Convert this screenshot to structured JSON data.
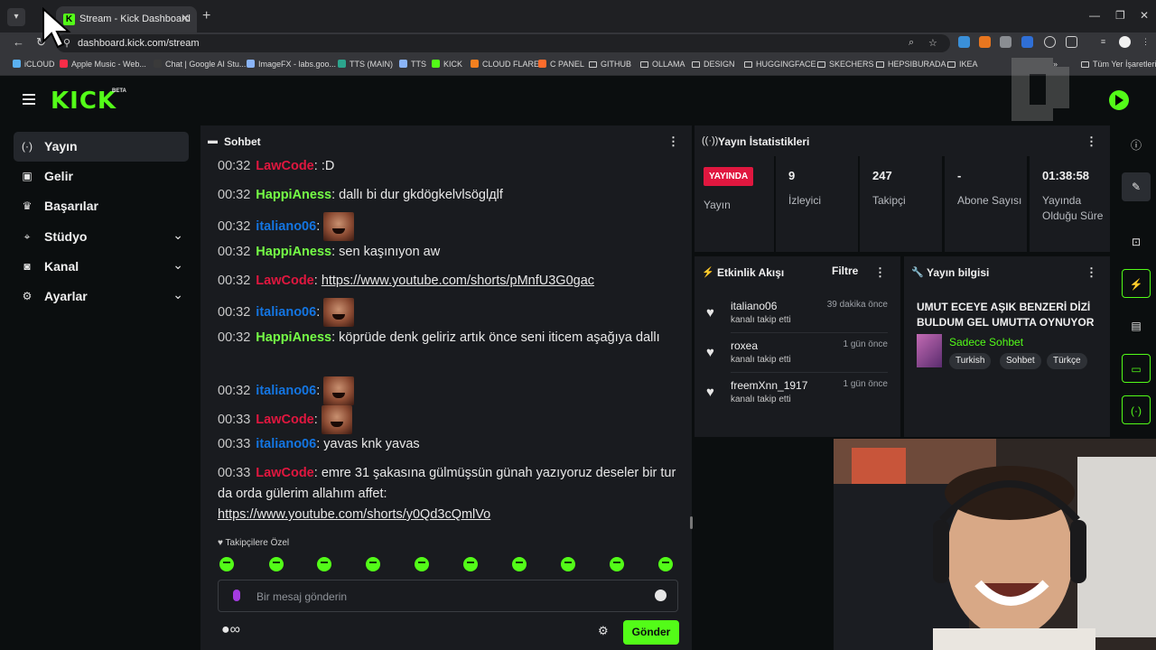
{
  "browser": {
    "tab_title": "Stream - Kick Dashboard",
    "new_tab": "+",
    "url": "dashboard.kick.com/stream",
    "bookmarks": [
      {
        "label": "iCLOUD",
        "kind": "site"
      },
      {
        "label": "Apple Music - Web...",
        "kind": "site"
      },
      {
        "label": "Chat | Google AI Stu...",
        "kind": "site"
      },
      {
        "label": "ImageFX - labs.goo...",
        "kind": "site"
      },
      {
        "label": "TTS (MAIN)",
        "kind": "site"
      },
      {
        "label": "TTS",
        "kind": "site"
      },
      {
        "label": "KICK",
        "kind": "site"
      },
      {
        "label": "CLOUD FLARE",
        "kind": "site"
      },
      {
        "label": "C PANEL",
        "kind": "site"
      },
      {
        "label": "GITHUB",
        "kind": "folder"
      },
      {
        "label": "OLLAMA",
        "kind": "folder"
      },
      {
        "label": "DESIGN",
        "kind": "folder"
      },
      {
        "label": "HUGGINGFACE",
        "kind": "folder"
      },
      {
        "label": "SKECHERS",
        "kind": "folder"
      },
      {
        "label": "HEPSIBURADA",
        "kind": "folder"
      },
      {
        "label": "IKEA",
        "kind": "folder"
      }
    ],
    "all_bookmarks": "Tüm Yer İşaretleri",
    "bookmarks_more": "»"
  },
  "header": {
    "logo": "KICK",
    "beta": "BETA"
  },
  "sidebar": {
    "items": [
      {
        "label": "Yayın",
        "icon": "broadcast-icon",
        "glyph": "(·)",
        "active": true,
        "expandable": false
      },
      {
        "label": "Gelir",
        "icon": "money-icon",
        "glyph": "▣",
        "active": false,
        "expandable": false
      },
      {
        "label": "Başarılar",
        "icon": "trophy-icon",
        "glyph": "♛",
        "active": false,
        "expandable": false
      },
      {
        "label": "Stüdyo",
        "icon": "studio-icon",
        "glyph": "⌖",
        "active": false,
        "expandable": true
      },
      {
        "label": "Kanal",
        "icon": "channel-icon",
        "glyph": "◙",
        "active": false,
        "expandable": true
      },
      {
        "label": "Ayarlar",
        "icon": "gear-icon",
        "glyph": "⚙",
        "active": false,
        "expandable": true
      }
    ]
  },
  "chat": {
    "title": "Sohbet",
    "messages": [
      {
        "time": "00:32",
        "user": "LawCode",
        "color": "#e0173f",
        "text": ":D"
      },
      {
        "time": "00:32",
        "user": "HappiAness",
        "color": "#75fd46",
        "text": "dallı bi dur gkdögkelvlsöglдlf"
      },
      {
        "time": "00:32",
        "user": "italiano06",
        "color": "#1475e1",
        "text": "",
        "emotes": 1
      },
      {
        "time": "00:32",
        "user": "HappiAness",
        "color": "#75fd46",
        "text": "sen kaşınıyon aw"
      },
      {
        "time": "00:32",
        "user": "LawCode",
        "color": "#e0173f",
        "link": "https://www.youtube.com/shorts/pMnfU3G0gac"
      },
      {
        "time": "00:32",
        "user": "italiano06",
        "color": "#1475e1",
        "text": "",
        "emotes": 1
      },
      {
        "time": "00:32",
        "user": "HappiAness",
        "color": "#75fd46",
        "text": "köprüde denk geliriz artık önce seni iticem aşağıya dallı"
      },
      {
        "time": "00:32",
        "user": "italiano06",
        "color": "#1475e1",
        "text": "",
        "emotes": 1
      },
      {
        "time": "00:33",
        "user": "LawCode",
        "color": "#e0173f",
        "text": "",
        "emotes": 1
      },
      {
        "time": "00:33",
        "user": "italiano06",
        "color": "#1475e1",
        "text": "yavas knk yavas"
      },
      {
        "time": "00:33",
        "user": "LawCode",
        "color": "#e0173f",
        "text": "emre 31 şakasına gülmüşsün günah yazıyoruz deseler bir tur da orda gülerim allahım affet:",
        "link": "https://www.youtube.com/shorts/y0Qd3cQmlVo"
      }
    ],
    "followers_only": "Takipçilere Özel",
    "input_placeholder": "Bir mesaj gönderin",
    "infinity": "∞",
    "send_label": "Gönder"
  },
  "stats": {
    "title": "Yayın İstatistikleri",
    "live_badge": "YAYINDA",
    "stream_label": "Yayın",
    "cells": [
      {
        "value": "9",
        "label": "İzleyici"
      },
      {
        "value": "247",
        "label": "Takipçi"
      },
      {
        "value": "-",
        "label": "Abone Sayısı"
      },
      {
        "value": "01:38:58",
        "label": "Yayında Olduğu Süre"
      }
    ]
  },
  "activity": {
    "title": "Etkinlik Akışı",
    "filter": "Filtre",
    "items": [
      {
        "user": "italiano06",
        "desc": "kanalı takip etti",
        "time": "39 dakika önce"
      },
      {
        "user": "roxea",
        "desc": "kanalı takip etti",
        "time": "1 gün önce"
      },
      {
        "user": "freemXnn_1917",
        "desc": "kanalı takip etti",
        "time": "1 gün önce"
      }
    ]
  },
  "stream_info": {
    "title_label": "Yayın bilgisi",
    "stream_title": "UMUT ECEYE AŞIK BENZERİ DİZİ BULDUM GEL UMUTTA OYNUYOR",
    "category": "Sadece Sohbet",
    "tags": [
      "Turkish",
      "Sohbet",
      "Türkçe"
    ]
  },
  "rail": {
    "buttons": [
      {
        "icon": "info-icon",
        "glyph": "ⓘ",
        "style": "plain"
      },
      {
        "icon": "edit-icon",
        "glyph": "✎",
        "style": "active"
      },
      {
        "icon": "clip-icon",
        "glyph": "⊡",
        "style": "plain"
      },
      {
        "icon": "lightning-icon",
        "glyph": "⚡",
        "style": "green"
      },
      {
        "icon": "notes-icon",
        "glyph": "▤",
        "style": "plain"
      },
      {
        "icon": "chat-bubble-icon",
        "glyph": "▭",
        "style": "green"
      },
      {
        "icon": "broadcast-rail-icon",
        "glyph": "(·)",
        "style": "green"
      }
    ]
  },
  "colors": {
    "kick_green": "#53fc18",
    "live_red": "#e0173f",
    "panel_bg": "#191b1f",
    "page_bg": "#0b0e0f"
  }
}
